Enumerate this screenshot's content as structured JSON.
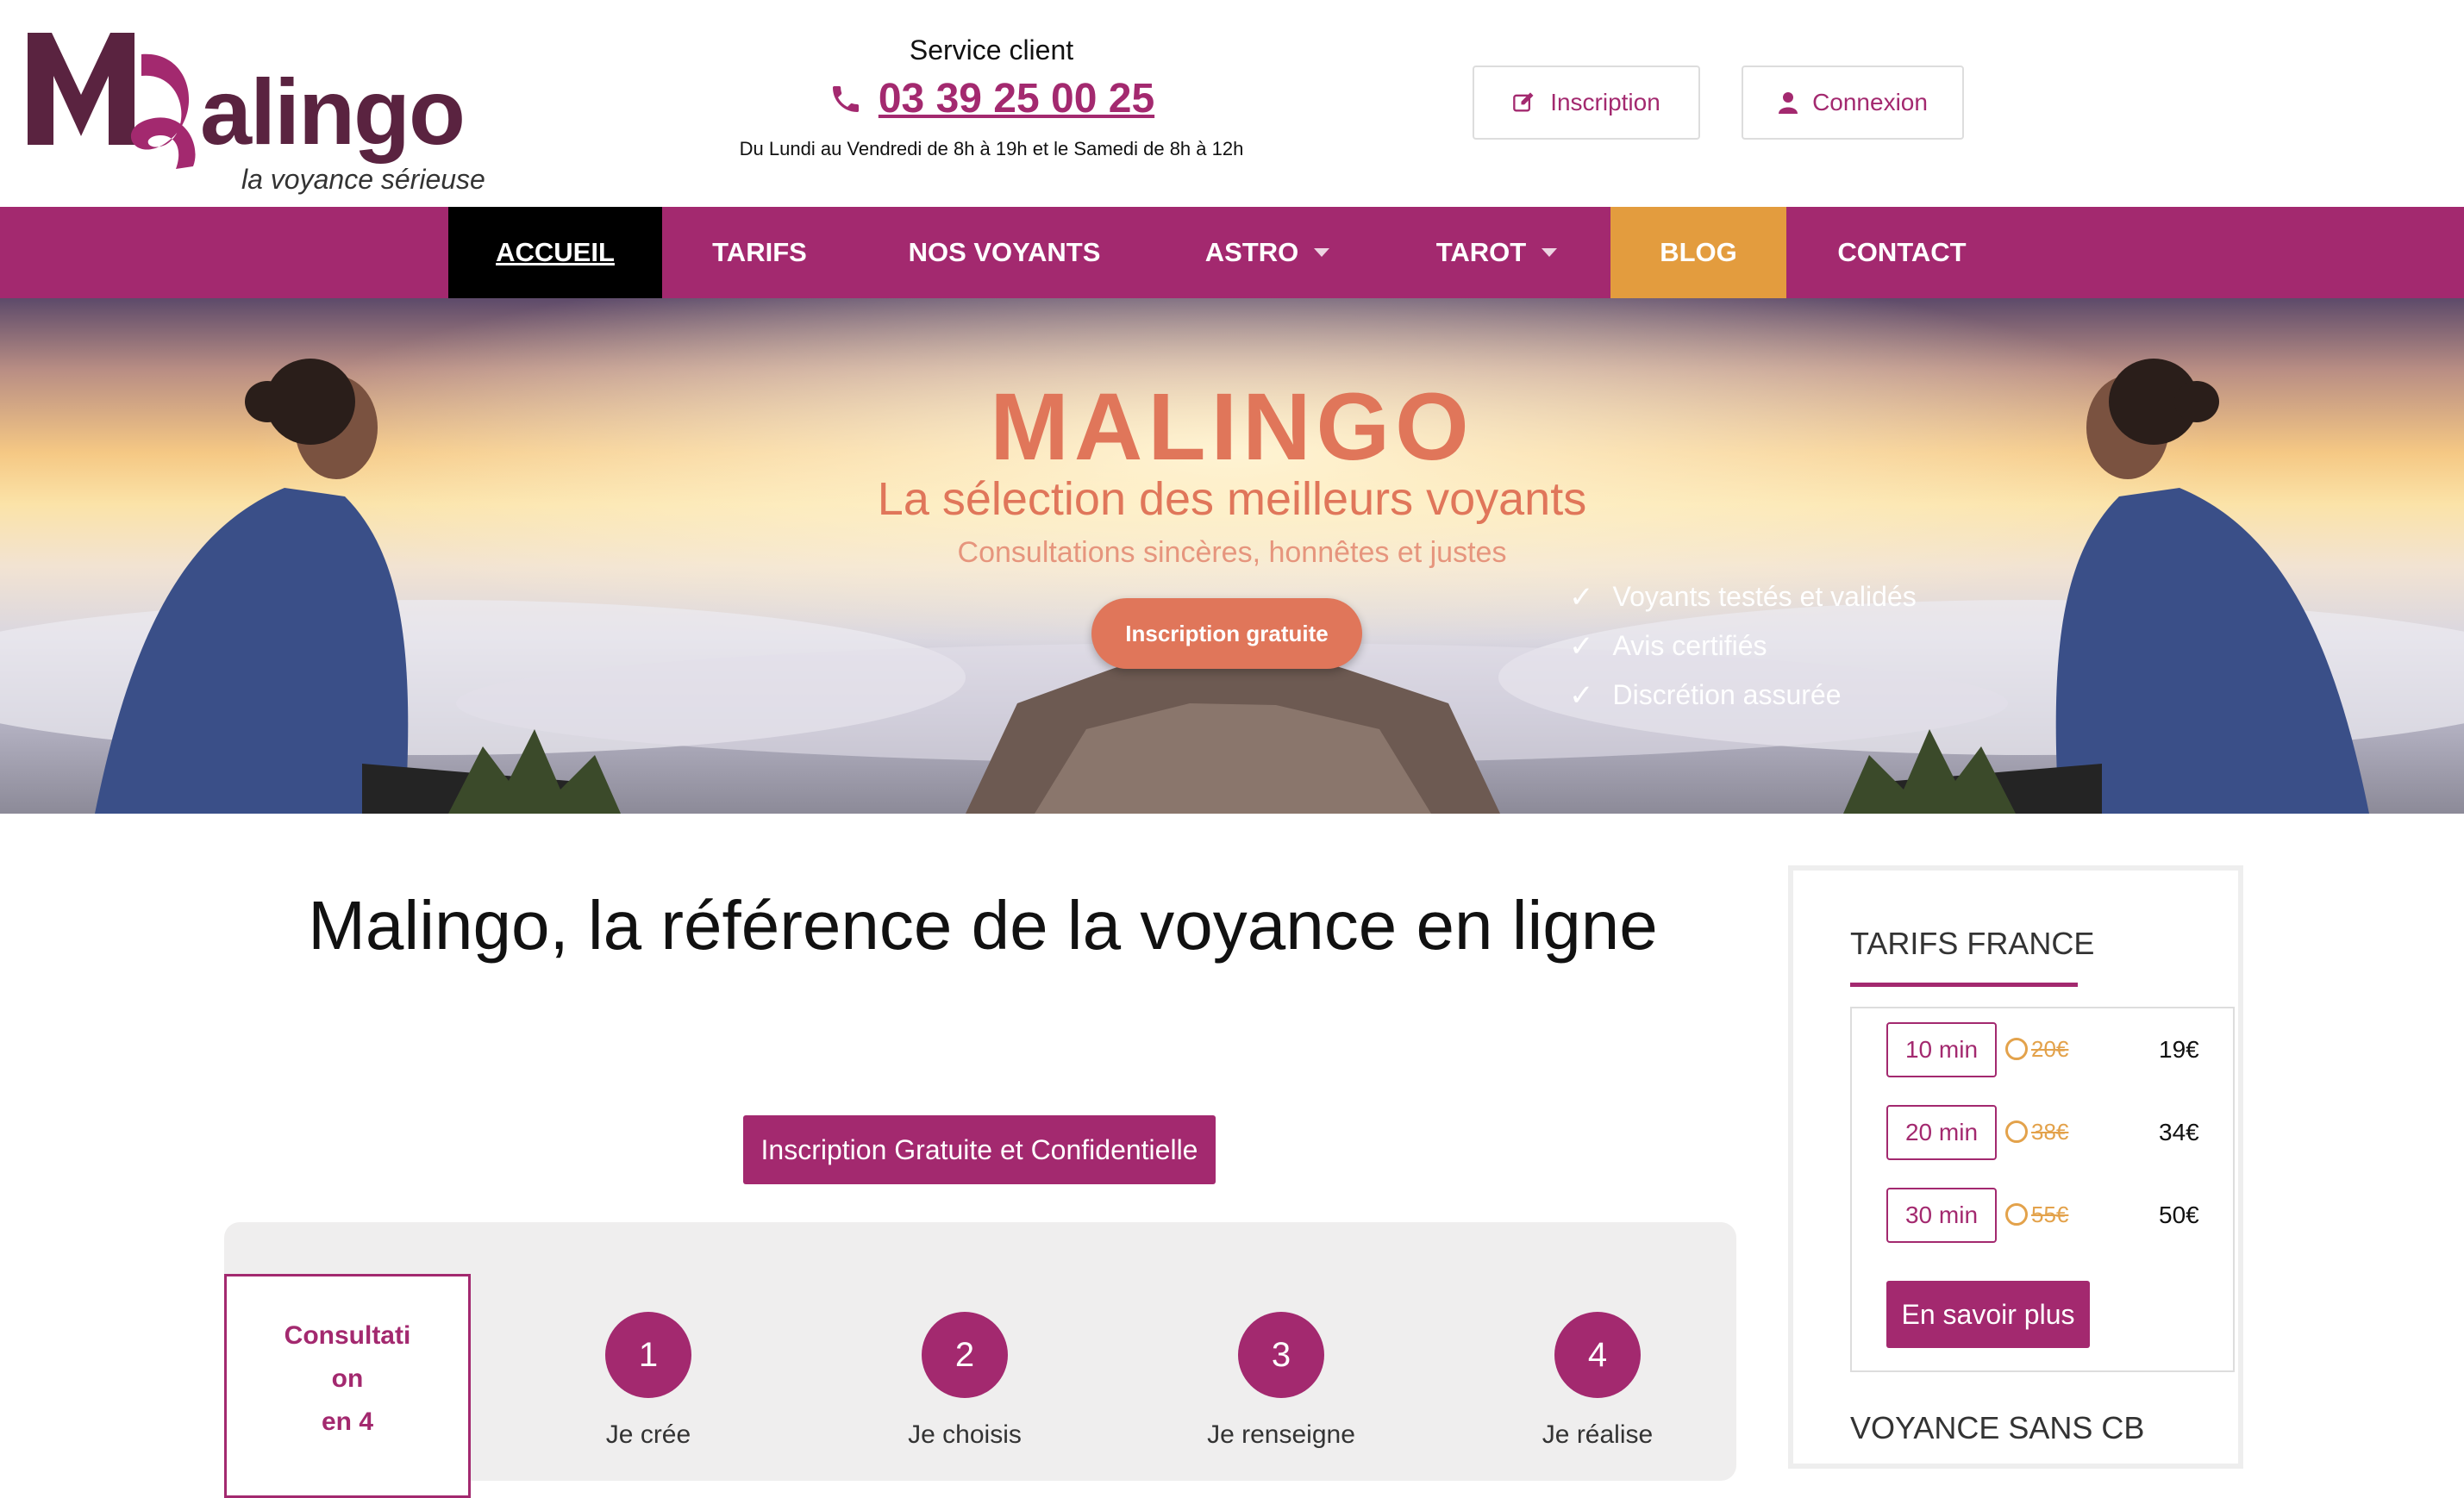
{
  "brand": {
    "logo_word": "alingo",
    "tagline": "la voyance sérieuse"
  },
  "header": {
    "service_title": "Service client",
    "phone": "03 39 25 00 25",
    "hours": "Du Lundi au Vendredi de 8h à 19h et le Samedi de 8h à 12h",
    "inscription_label": "Inscription",
    "connexion_label": "Connexion"
  },
  "nav": {
    "items": [
      {
        "label": "ACCUEIL",
        "active": true
      },
      {
        "label": "TARIFS"
      },
      {
        "label": "NOS VOYANTS"
      },
      {
        "label": "ASTRO",
        "dropdown": true
      },
      {
        "label": "TAROT",
        "dropdown": true
      },
      {
        "label": "BLOG",
        "highlight": true
      },
      {
        "label": "CONTACT"
      }
    ]
  },
  "hero": {
    "title": "MALINGO",
    "subtitle": "La sélection des meilleurs voyants",
    "tagline": "Consultations sincères, honnêtes et justes",
    "cta": "Inscription gratuite",
    "checks": [
      "Voyants testés et validés",
      "Avis certifiés",
      "Discrétion assurée"
    ]
  },
  "main": {
    "title": "Malingo, la référence de la voyance en ligne",
    "cta": "Inscription Gratuite et Confidentielle",
    "consult_box": [
      "Consultati",
      "on",
      "en 4"
    ],
    "steps": [
      {
        "num": "1",
        "label": "Je crée"
      },
      {
        "num": "2",
        "label": "Je choisis"
      },
      {
        "num": "3",
        "label": "Je renseigne"
      },
      {
        "num": "4",
        "label": "Je réalise"
      }
    ]
  },
  "sidebar": {
    "tarifs_title": "TARIFS FRANCE",
    "tarifs": [
      {
        "duration": "10 min",
        "old": "20€",
        "new": "19€"
      },
      {
        "duration": "20 min",
        "old": "38€",
        "new": "34€"
      },
      {
        "duration": "30 min",
        "old": "55€",
        "new": "50€"
      }
    ],
    "more_button": "En savoir plus",
    "sans_cb_title": "VOYANCE SANS CB"
  },
  "colors": {
    "brand": "#a3296f",
    "logo_dark": "#5a2340",
    "nav_active_bg": "#000000",
    "nav_blog_bg": "#e39c3e",
    "hero_accent": "#e0765a",
    "old_price": "#e3a24b"
  },
  "icons": {
    "phone": "phone-icon",
    "inscription": "edit-icon",
    "connexion": "user-icon",
    "check": "check-icon",
    "caret": "caret-down-icon"
  }
}
